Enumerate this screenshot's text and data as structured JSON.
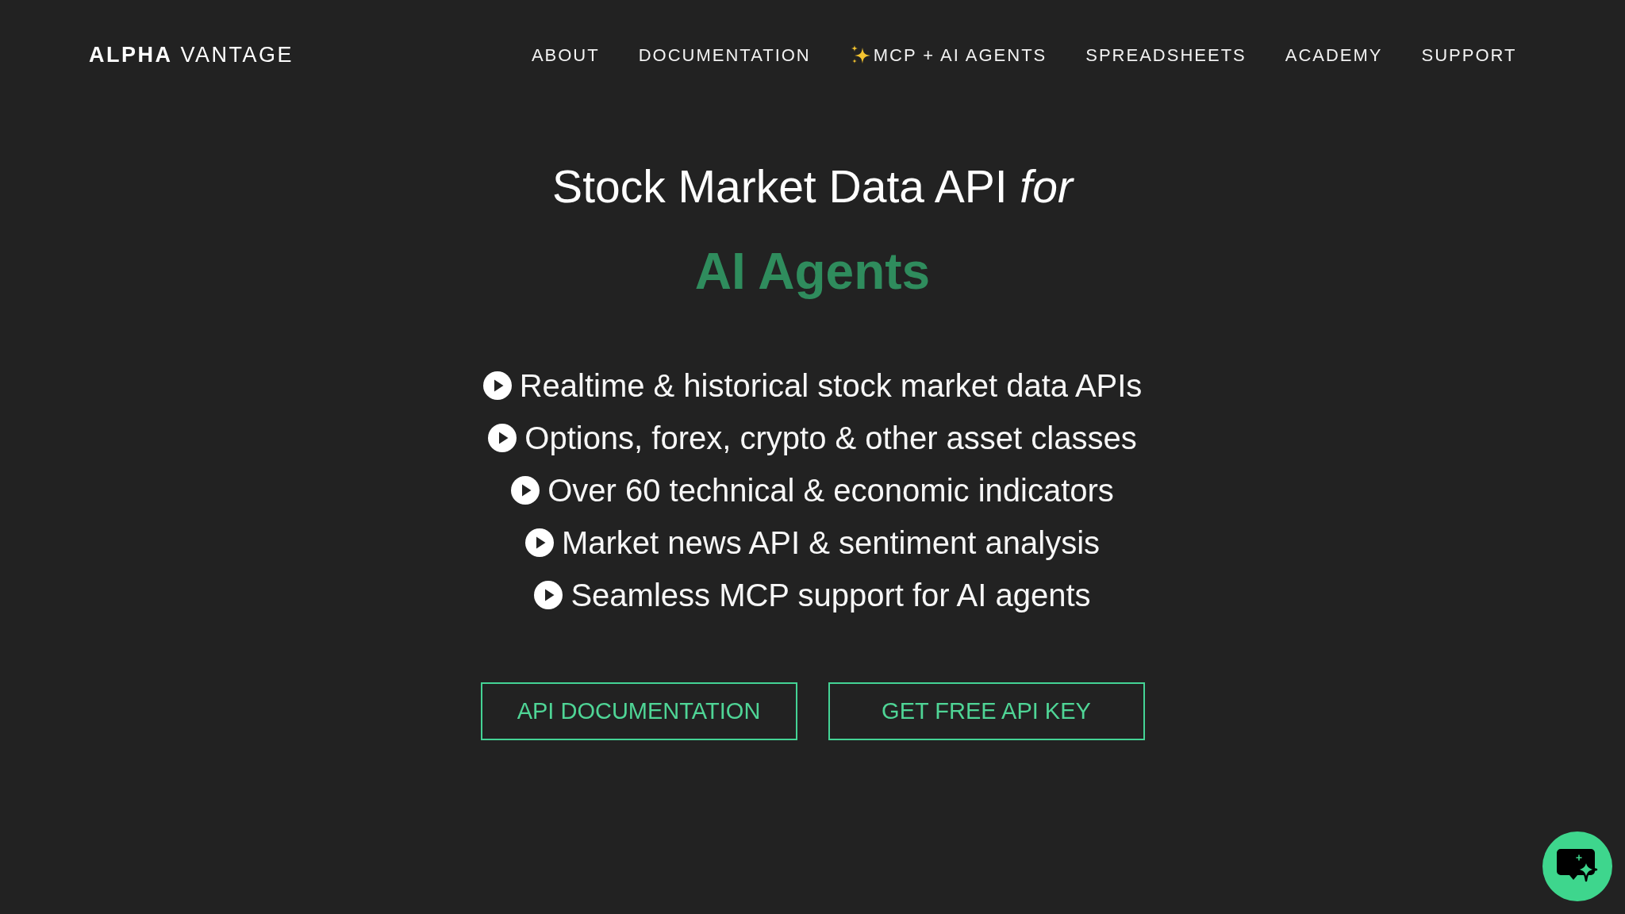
{
  "header": {
    "logo": "**ALPHA** VANTAGE",
    "nav": [
      {
        "label": "ABOUT",
        "kind": "plain"
      },
      {
        "label": "DOCUMENTATION",
        "kind": "plain"
      },
      {
        "label": "MCP + AI AGENTS",
        "kind": "featured"
      },
      {
        "label": "SPREADSHEETS",
        "kind": "plain"
      },
      {
        "label": "ACADEMY",
        "kind": "plain"
      },
      {
        "label": "SUPPORT",
        "kind": "plain"
      }
    ]
  },
  "hero": {
    "title": "Stock Market Data API *for*",
    "highlight": "AI Agents",
    "features": [
      "Realtime & historical stock market data APIs",
      "Options, forex, crypto & other asset classes",
      "Over 60 technical & economic indicators",
      "Market news API & sentiment analysis",
      "Seamless MCP support for AI agents"
    ],
    "buttons": [
      {
        "label": "API DOCUMENTATION"
      },
      {
        "label": "GET FREE API KEY"
      }
    ]
  }
}
